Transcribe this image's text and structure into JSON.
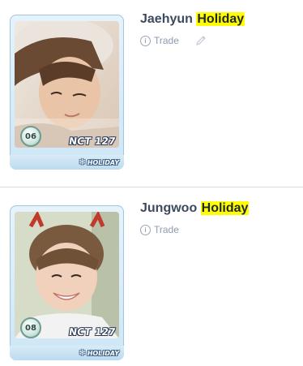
{
  "items": [
    {
      "name_prefix": "Jaehyun ",
      "name_highlight": "Holiday",
      "card_number": "06",
      "group": "NCT 127",
      "series_tag": "HOLIDAY",
      "trade_label": "Trade",
      "has_edit": true
    },
    {
      "name_prefix": "Jungwoo ",
      "name_highlight": "Holiday",
      "card_number": "08",
      "group": "NCT 127",
      "series_tag": "HOLIDAY",
      "trade_label": "Trade",
      "has_edit": false
    }
  ],
  "colors": {
    "highlight": "#ffff00",
    "title_text": "#3b4a5e",
    "meta_text": "#8e9bb0",
    "card_frame": "#cde6f6"
  },
  "icons": [
    "info-icon",
    "pencil-icon",
    "snowflake-icon"
  ]
}
